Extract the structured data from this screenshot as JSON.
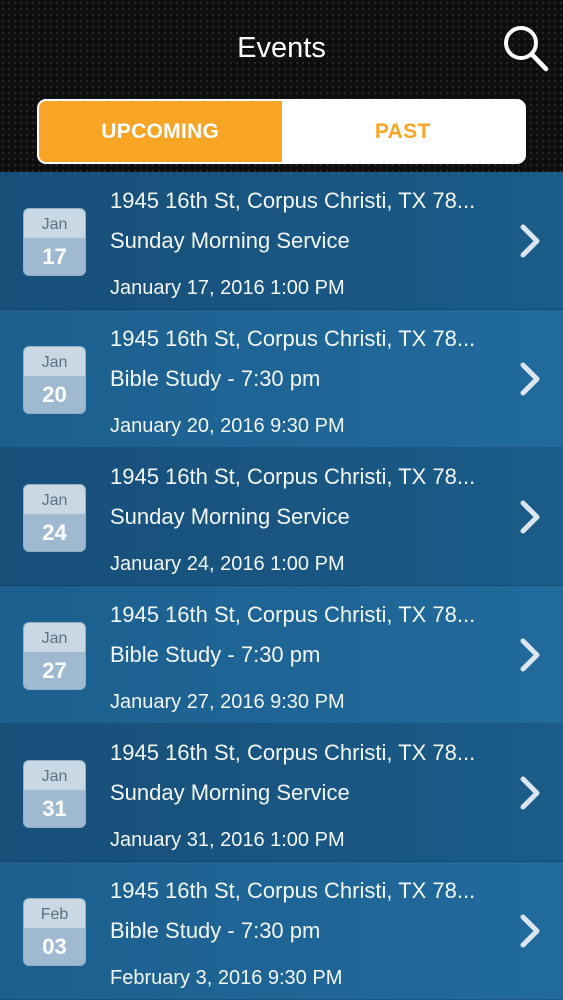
{
  "header": {
    "title": "Events",
    "search_icon": "search-icon"
  },
  "tabs": {
    "upcoming_label": "UPCOMING",
    "past_label": "PAST",
    "selected": "UPCOMING"
  },
  "colors": {
    "accent": "#f8a424",
    "header_bg": "#0e0e0e",
    "list_bg_dark": "#174f79",
    "list_bg_light": "#1c5f8e"
  },
  "events": [
    {
      "month": "Jan",
      "day": "17",
      "address": "1945 16th St, Corpus Christi, TX 78...",
      "name": "Sunday Morning Service",
      "datetime": "January 17, 2016 1:00 PM"
    },
    {
      "month": "Jan",
      "day": "20",
      "address": "1945 16th St, Corpus Christi, TX 78...",
      "name": "Bible Study - 7:30 pm",
      "datetime": "January 20, 2016 9:30 PM"
    },
    {
      "month": "Jan",
      "day": "24",
      "address": "1945 16th St, Corpus Christi, TX 78...",
      "name": "Sunday Morning Service",
      "datetime": "January 24, 2016 1:00 PM"
    },
    {
      "month": "Jan",
      "day": "27",
      "address": "1945 16th St, Corpus Christi, TX 78...",
      "name": "Bible Study - 7:30 pm",
      "datetime": "January 27, 2016 9:30 PM"
    },
    {
      "month": "Jan",
      "day": "31",
      "address": "1945 16th St, Corpus Christi, TX 78...",
      "name": "Sunday Morning Service",
      "datetime": "January 31, 2016 1:00 PM"
    },
    {
      "month": "Feb",
      "day": "03",
      "address": "1945 16th St, Corpus Christi, TX 78...",
      "name": "Bible Study - 7:30 pm",
      "datetime": "February 3, 2016 9:30 PM"
    }
  ]
}
